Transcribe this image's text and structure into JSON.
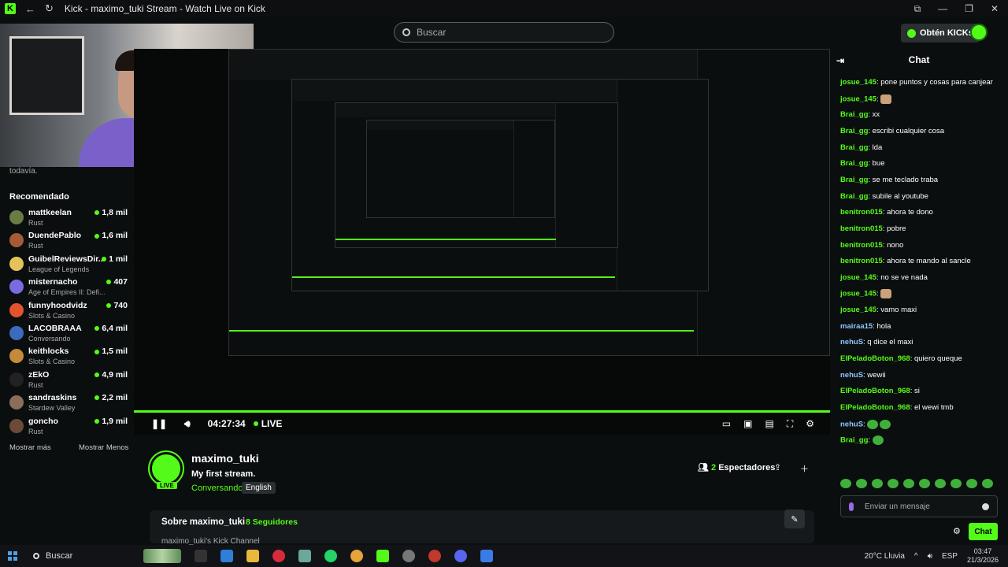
{
  "window": {
    "title": "Kick - maximo_tuki Stream - Watch Live on Kick"
  },
  "topbar": {
    "search_placeholder": "Buscar",
    "kicks_label": "Obtén KICKs"
  },
  "sidebar": {
    "truncated": "todavía.",
    "heading": "Recomendado",
    "channels": [
      {
        "name": "mattkeelan",
        "category": "Rust",
        "viewers": "1,8 mil"
      },
      {
        "name": "DuendePablo",
        "category": "Rust",
        "viewers": "1,6 mil"
      },
      {
        "name": "GuibelReviewsDir...",
        "category": "League of Legends",
        "viewers": "1 mil"
      },
      {
        "name": "misternacho",
        "category": "Age of Empires II: Defi...",
        "viewers": "407"
      },
      {
        "name": "funnyhoodvidz",
        "category": "Slots & Casino",
        "viewers": "740"
      },
      {
        "name": "LACOBRAAA",
        "category": "Conversando",
        "viewers": "6,4 mil"
      },
      {
        "name": "keithlocks",
        "category": "Slots & Casino",
        "viewers": "1,5 mil"
      },
      {
        "name": "zEkO",
        "category": "Rust",
        "viewers": "4,9 mil"
      },
      {
        "name": "sandraskins",
        "category": "Stardew Valley",
        "viewers": "2,2 mil"
      },
      {
        "name": "goncho",
        "category": "Rust",
        "viewers": "1,9 mil"
      }
    ],
    "show_more": "Mostrar más",
    "show_less": "Mostrar Menos"
  },
  "player": {
    "time": "04:27:34",
    "live": "LIVE",
    "progress": 1.0
  },
  "stream": {
    "streamer": "maximo_tuki",
    "live_tag": "LIVE",
    "title": "My first stream.",
    "category": "Conversando",
    "language": "English",
    "viewers_count": "2",
    "viewers_label": "Espectadores",
    "about_title": "Sobre maximo_tuki",
    "followers": "8 Seguidores",
    "channel_text": "maximo_tuki's Kick Channel"
  },
  "chat": {
    "title": "Chat",
    "messages": [
      {
        "user": "josue_145",
        "text": ": pone puntos y cosas para canjear"
      },
      {
        "user": "josue_145",
        "text": ":",
        "emote": "face"
      },
      {
        "user": "Brai_gg",
        "text": ": xx"
      },
      {
        "user": "Brai_gg",
        "text": ": escribi cualquier cosa"
      },
      {
        "user": "Brai_gg",
        "text": ": lda"
      },
      {
        "user": "Brai_gg",
        "text": ": bue"
      },
      {
        "user": "Brai_gg",
        "text": ": se me teclado traba"
      },
      {
        "user": "Brai_gg",
        "text": ": subile al youtube"
      },
      {
        "user": "benitron015",
        "text": ": ahora te dono"
      },
      {
        "user": "benitron015",
        "text": ": pobre"
      },
      {
        "user": "benitron015",
        "text": ": nono"
      },
      {
        "user": "benitron015",
        "text": ": ahora te mando al sancle"
      },
      {
        "user": "josue_145",
        "text": ": no se ve nada"
      },
      {
        "user": "josue_145",
        "text": ":",
        "emote": "face"
      },
      {
        "user": "josue_145",
        "text": ": vamo maxi"
      },
      {
        "user": "mairaa15",
        "text": ": hola"
      },
      {
        "user": "nehuS",
        "text": ": q dice el maxi"
      },
      {
        "user": "ElPeladoBoton_968",
        "text": ": quiero queque"
      },
      {
        "user": "nehuS",
        "text": ": wewii"
      },
      {
        "user": "ElPeladoBoton_968",
        "text": ": si"
      },
      {
        "user": "ElPeladoBoton_968",
        "text": ": el wewi tmb"
      },
      {
        "user": "nehuS",
        "text": ":",
        "emote": "green2"
      },
      {
        "user": "Brai_gg",
        "text": ":",
        "emote": "green1"
      }
    ],
    "input_placeholder": "Enviar un mensaje",
    "send_label": "Chat"
  },
  "taskbar": {
    "search": "Buscar",
    "weather": "20°C  Lluvia",
    "lang": "ESP",
    "time": "03:47",
    "date": "21/3/2026"
  }
}
